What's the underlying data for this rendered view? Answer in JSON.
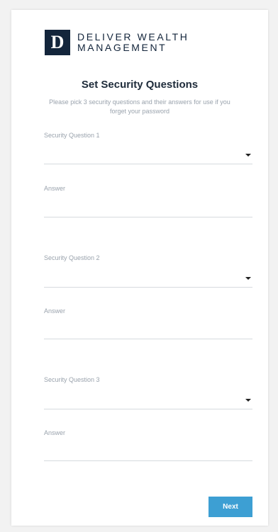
{
  "brand": {
    "logo_letter": "D",
    "line1": "DELIVER WEALTH",
    "line2": "MANAGEMENT"
  },
  "form": {
    "title": "Set Security Questions",
    "subtitle": "Please pick 3 security questions and their answers for use if you forget your password",
    "questions": [
      {
        "label": "Security Question 1",
        "selected": "",
        "answer_label": "Answer",
        "answer_value": ""
      },
      {
        "label": "Security Question 2",
        "selected": "",
        "answer_label": "Answer",
        "answer_value": ""
      },
      {
        "label": "Security Question 3",
        "selected": "",
        "answer_label": "Answer",
        "answer_value": ""
      }
    ],
    "next_label": "Next"
  },
  "colors": {
    "brand_navy": "#13253b",
    "button_blue": "#3d9fd3",
    "muted_text": "#9aa3ad",
    "divider": "#d6dade"
  }
}
